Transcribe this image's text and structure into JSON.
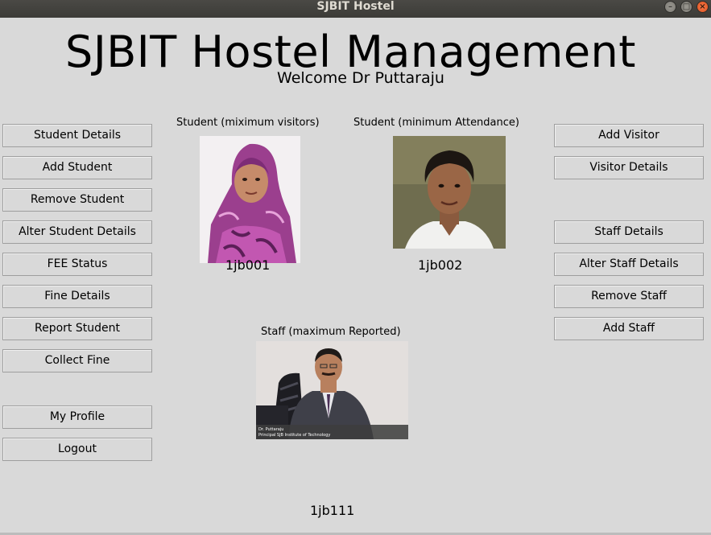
{
  "window": {
    "title": "SJBIT Hostel"
  },
  "header": {
    "title": "SJBIT Hostel Management",
    "welcome": "Welcome Dr Puttaraju"
  },
  "left_buttons": [
    "Student Details",
    "Add Student",
    "Remove Student",
    "Alter Student Details",
    "FEE Status",
    "Fine Details",
    "Report Student",
    "Collect Fine",
    "My Profile",
    "Logout"
  ],
  "right_buttons": [
    "Add Visitor",
    "Visitor Details",
    "Staff Details",
    "Alter Staff Details",
    "Remove Staff",
    "Add Staff"
  ],
  "cards": {
    "max_visitors": {
      "caption": "Student (miximum visitors)",
      "id": "1jb001"
    },
    "min_attendance": {
      "caption": "Student (minimum Attendance)",
      "id": "1jb002"
    },
    "max_reported": {
      "caption": "Staff (maximum Reported)",
      "id": "1jb111",
      "photo_text_line1": "Dr. Puttaraju",
      "photo_text_line2": "Principal SJB Institute of Technology"
    }
  },
  "colors": {
    "window_bg": "#d9d9d9",
    "titlebar": "#3c3b37",
    "close_button": "#e95420"
  }
}
